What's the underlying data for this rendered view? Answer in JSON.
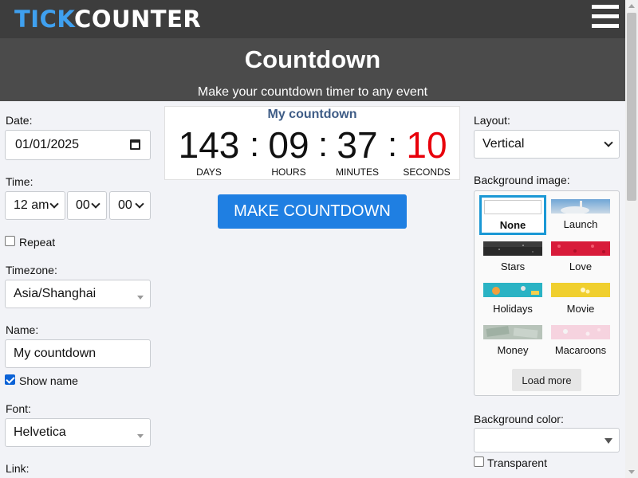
{
  "header": {
    "logo_tick": "TICK",
    "logo_counter": "COUNTER",
    "menu_icon": "hamburger-icon"
  },
  "hero": {
    "title": "Countdown",
    "subtitle": "Make your countdown timer to any event"
  },
  "left": {
    "date_label": "Date:",
    "date_value": "01/01/2025",
    "time_label": "Time:",
    "hour": "12 am",
    "minute": "00",
    "second": "00",
    "repeat_label": "Repeat",
    "repeat_checked": false,
    "timezone_label": "Timezone:",
    "timezone_value": "Asia/Shanghai",
    "name_label": "Name:",
    "name_value": "My countdown",
    "show_name_label": "Show name",
    "show_name_checked": true,
    "font_label": "Font:",
    "font_value": "Helvetica",
    "link_label": "Link:"
  },
  "counter": {
    "title": "My countdown",
    "days": "143",
    "hours": "09",
    "minutes": "37",
    "seconds": "10",
    "separator": ":",
    "days_label": "DAYS",
    "hours_label": "HOURS",
    "minutes_label": "MINUTES",
    "seconds_label": "SECONDS",
    "seconds_color": "#e8000b",
    "title_color": "#3e5c86"
  },
  "make_button": "MAKE COUNTDOWN",
  "right": {
    "layout_label": "Layout:",
    "layout_value": "Vertical",
    "bg_image_label": "Background image:",
    "images": [
      {
        "label": "None",
        "selected": true
      },
      {
        "label": "Launch",
        "selected": false
      },
      {
        "label": "Stars",
        "selected": false
      },
      {
        "label": "Love",
        "selected": false
      },
      {
        "label": "Holidays",
        "selected": false
      },
      {
        "label": "Movie",
        "selected": false
      },
      {
        "label": "Money",
        "selected": false
      },
      {
        "label": "Macaroons",
        "selected": false
      }
    ],
    "load_more": "Load more",
    "bg_color_label": "Background color:",
    "bg_color_value": "",
    "transparent_label": "Transparent",
    "transparent_checked": false
  },
  "colors": {
    "topbar": "#3d3d3d",
    "hero": "#4b4b4b",
    "logo_accent": "#3fa0ef",
    "button": "#1f7fe2",
    "selected_border": "#1a98d5"
  }
}
